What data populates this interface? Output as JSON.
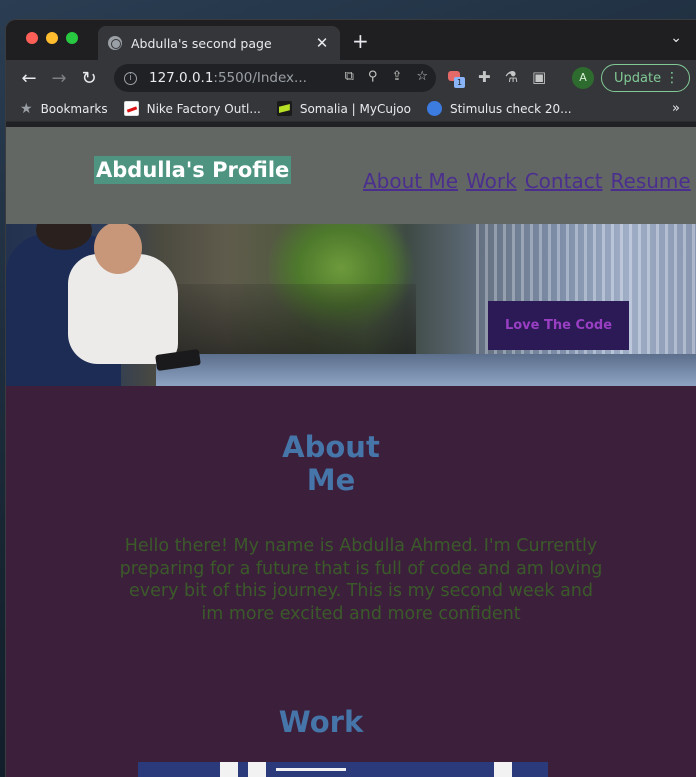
{
  "browser": {
    "tab_title": "Abdulla's second page",
    "tab_close": "✕",
    "new_tab": "+",
    "tab_menu": "⌄",
    "back": "←",
    "forward": "→",
    "reload": "↻",
    "url_host": "127.0.0.1",
    "url_rest": ":5500/Index...",
    "avatar_initial": "A",
    "update_label": "Update",
    "kebab": "⋮",
    "bookmarks": [
      {
        "label": "Bookmarks",
        "icon": "star-icon"
      },
      {
        "label": "Nike Factory Outl...",
        "icon": "nike-icon"
      },
      {
        "label": "Somalia | MyCujoo",
        "icon": "somalia-icon"
      },
      {
        "label": "Stimulus check 20...",
        "icon": "stimulus-icon"
      }
    ],
    "bookmarks_more": "»",
    "ext_badge_count": "1"
  },
  "site": {
    "title": "Abdulla's Profile",
    "nav": [
      "About Me",
      "Work",
      "Contact",
      "Resume"
    ],
    "hero_button": "Love The Code",
    "about_heading": "About Me",
    "about_text": "Hello there! My name is Abdulla Ahmed. I'm Currently preparing for a future that is full of code and am loving every bit of this journey. This is my second week and im more excited and more confident",
    "work_heading": "Work"
  },
  "colors": {
    "header_bg": "#636764",
    "title_bg": "#4e9481",
    "nav_link": "#4b2f8f",
    "page_bg": "#3c1f3b",
    "heading": "#4676a9",
    "body_text": "#3b5a2a",
    "hero_button_bg": "#2b1a55",
    "hero_button_text": "#9a3fc4",
    "update_accent": "#81c995"
  }
}
